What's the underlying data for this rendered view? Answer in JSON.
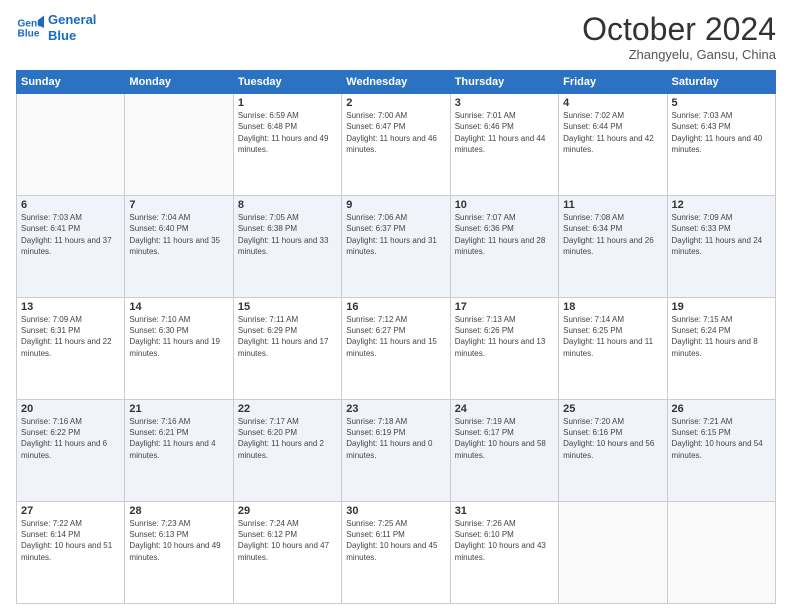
{
  "logo": {
    "line1": "General",
    "line2": "Blue"
  },
  "title": "October 2024",
  "location": "Zhangyelu, Gansu, China",
  "weekdays": [
    "Sunday",
    "Monday",
    "Tuesday",
    "Wednesday",
    "Thursday",
    "Friday",
    "Saturday"
  ],
  "weeks": [
    [
      {
        "day": "",
        "text": ""
      },
      {
        "day": "",
        "text": ""
      },
      {
        "day": "1",
        "text": "Sunrise: 6:59 AM\nSunset: 6:48 PM\nDaylight: 11 hours and 49 minutes."
      },
      {
        "day": "2",
        "text": "Sunrise: 7:00 AM\nSunset: 6:47 PM\nDaylight: 11 hours and 46 minutes."
      },
      {
        "day": "3",
        "text": "Sunrise: 7:01 AM\nSunset: 6:46 PM\nDaylight: 11 hours and 44 minutes."
      },
      {
        "day": "4",
        "text": "Sunrise: 7:02 AM\nSunset: 6:44 PM\nDaylight: 11 hours and 42 minutes."
      },
      {
        "day": "5",
        "text": "Sunrise: 7:03 AM\nSunset: 6:43 PM\nDaylight: 11 hours and 40 minutes."
      }
    ],
    [
      {
        "day": "6",
        "text": "Sunrise: 7:03 AM\nSunset: 6:41 PM\nDaylight: 11 hours and 37 minutes."
      },
      {
        "day": "7",
        "text": "Sunrise: 7:04 AM\nSunset: 6:40 PM\nDaylight: 11 hours and 35 minutes."
      },
      {
        "day": "8",
        "text": "Sunrise: 7:05 AM\nSunset: 6:38 PM\nDaylight: 11 hours and 33 minutes."
      },
      {
        "day": "9",
        "text": "Sunrise: 7:06 AM\nSunset: 6:37 PM\nDaylight: 11 hours and 31 minutes."
      },
      {
        "day": "10",
        "text": "Sunrise: 7:07 AM\nSunset: 6:36 PM\nDaylight: 11 hours and 28 minutes."
      },
      {
        "day": "11",
        "text": "Sunrise: 7:08 AM\nSunset: 6:34 PM\nDaylight: 11 hours and 26 minutes."
      },
      {
        "day": "12",
        "text": "Sunrise: 7:09 AM\nSunset: 6:33 PM\nDaylight: 11 hours and 24 minutes."
      }
    ],
    [
      {
        "day": "13",
        "text": "Sunrise: 7:09 AM\nSunset: 6:31 PM\nDaylight: 11 hours and 22 minutes."
      },
      {
        "day": "14",
        "text": "Sunrise: 7:10 AM\nSunset: 6:30 PM\nDaylight: 11 hours and 19 minutes."
      },
      {
        "day": "15",
        "text": "Sunrise: 7:11 AM\nSunset: 6:29 PM\nDaylight: 11 hours and 17 minutes."
      },
      {
        "day": "16",
        "text": "Sunrise: 7:12 AM\nSunset: 6:27 PM\nDaylight: 11 hours and 15 minutes."
      },
      {
        "day": "17",
        "text": "Sunrise: 7:13 AM\nSunset: 6:26 PM\nDaylight: 11 hours and 13 minutes."
      },
      {
        "day": "18",
        "text": "Sunrise: 7:14 AM\nSunset: 6:25 PM\nDaylight: 11 hours and 11 minutes."
      },
      {
        "day": "19",
        "text": "Sunrise: 7:15 AM\nSunset: 6:24 PM\nDaylight: 11 hours and 8 minutes."
      }
    ],
    [
      {
        "day": "20",
        "text": "Sunrise: 7:16 AM\nSunset: 6:22 PM\nDaylight: 11 hours and 6 minutes."
      },
      {
        "day": "21",
        "text": "Sunrise: 7:16 AM\nSunset: 6:21 PM\nDaylight: 11 hours and 4 minutes."
      },
      {
        "day": "22",
        "text": "Sunrise: 7:17 AM\nSunset: 6:20 PM\nDaylight: 11 hours and 2 minutes."
      },
      {
        "day": "23",
        "text": "Sunrise: 7:18 AM\nSunset: 6:19 PM\nDaylight: 11 hours and 0 minutes."
      },
      {
        "day": "24",
        "text": "Sunrise: 7:19 AM\nSunset: 6:17 PM\nDaylight: 10 hours and 58 minutes."
      },
      {
        "day": "25",
        "text": "Sunrise: 7:20 AM\nSunset: 6:16 PM\nDaylight: 10 hours and 56 minutes."
      },
      {
        "day": "26",
        "text": "Sunrise: 7:21 AM\nSunset: 6:15 PM\nDaylight: 10 hours and 54 minutes."
      }
    ],
    [
      {
        "day": "27",
        "text": "Sunrise: 7:22 AM\nSunset: 6:14 PM\nDaylight: 10 hours and 51 minutes."
      },
      {
        "day": "28",
        "text": "Sunrise: 7:23 AM\nSunset: 6:13 PM\nDaylight: 10 hours and 49 minutes."
      },
      {
        "day": "29",
        "text": "Sunrise: 7:24 AM\nSunset: 6:12 PM\nDaylight: 10 hours and 47 minutes."
      },
      {
        "day": "30",
        "text": "Sunrise: 7:25 AM\nSunset: 6:11 PM\nDaylight: 10 hours and 45 minutes."
      },
      {
        "day": "31",
        "text": "Sunrise: 7:26 AM\nSunset: 6:10 PM\nDaylight: 10 hours and 43 minutes."
      },
      {
        "day": "",
        "text": ""
      },
      {
        "day": "",
        "text": ""
      }
    ]
  ]
}
